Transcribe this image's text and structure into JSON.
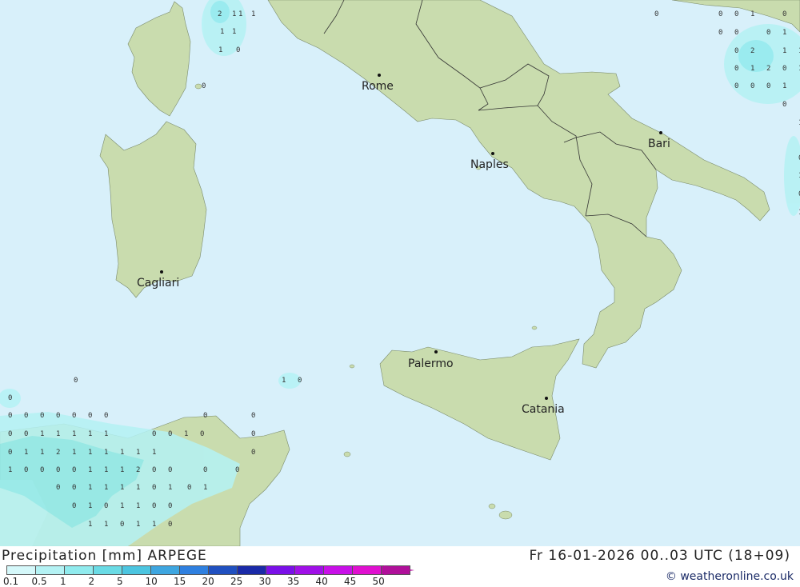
{
  "header": {
    "title": "Precipitation [mm] ARPEGE",
    "valid_time": "Fr 16-01-2026 00..03 UTC (18+09)",
    "credit": "© weatheronline.co.uk"
  },
  "cities": {
    "rome": "Rome",
    "naples": "Naples",
    "bari": "Bari",
    "cagliari": "Cagliari",
    "palermo": "Palermo",
    "catania": "Catania"
  },
  "legend": {
    "labels": [
      "0.1",
      "0.5",
      "1",
      "2",
      "5",
      "10",
      "15",
      "20",
      "25",
      "30",
      "35",
      "40",
      "45",
      "50"
    ],
    "colors": [
      "#d5f8fa",
      "#b4f2f4",
      "#90ebee",
      "#6adbe5",
      "#4cc5e0",
      "#3ea6e0",
      "#2f80e0",
      "#2050c0",
      "#1a2aa8",
      "#7a10e8",
      "#a010e8",
      "#c810e8",
      "#e010d0",
      "#b0109a"
    ]
  },
  "colors": {
    "sea": "#d8f0fa",
    "land": "#c9dcae",
    "precip_light": "#b4f2f4",
    "precip_mid": "#90ebee"
  },
  "precip_values": [
    "2",
    "1",
    "1",
    "1",
    "1",
    "1",
    "1",
    "0",
    "0",
    "0",
    "0",
    "0",
    "1",
    "0",
    "0",
    "0",
    "0",
    "1",
    "0",
    "2",
    "1",
    "1",
    "0",
    "1",
    "2",
    "0",
    "1",
    "0",
    "0",
    "0",
    "1",
    "0",
    "1",
    "0",
    "1",
    "0",
    "1",
    "0",
    "1",
    "0",
    "0",
    "0",
    "0",
    "0",
    "0",
    "0",
    "0",
    "0",
    "0",
    "0",
    "0",
    "0",
    "0",
    "1",
    "1",
    "1",
    "1",
    "1",
    "0",
    "0",
    "1",
    "0",
    "0",
    "0",
    "1",
    "1",
    "2",
    "1",
    "1",
    "1",
    "1",
    "1",
    "1",
    "1",
    "0",
    "0",
    "0",
    "0",
    "1",
    "1",
    "1",
    "2",
    "0",
    "0",
    "0",
    "0",
    "0",
    "0",
    "1",
    "1",
    "1",
    "1",
    "0",
    "1",
    "0",
    "1",
    "0",
    "1",
    "0",
    "1",
    "1",
    "0",
    "0",
    "1",
    "1",
    "0",
    "1",
    "1",
    "0",
    "0",
    "0"
  ]
}
